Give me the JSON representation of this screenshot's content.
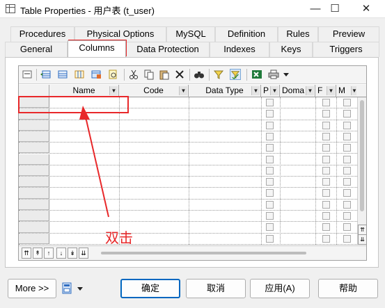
{
  "window": {
    "title": "Table Properties - 用户表 (t_user)",
    "minimize_label": "—",
    "maximize_label": "☐",
    "close_label": "✕"
  },
  "tabs": {
    "row1": [
      "Procedures",
      "Physical Options",
      "MySQL",
      "Definition",
      "Rules",
      "Preview"
    ],
    "row2": [
      "General",
      "Columns",
      "Data Protection",
      "Indexes",
      "Keys",
      "Triggers"
    ],
    "active": "Columns"
  },
  "grid": {
    "columns": [
      "Name",
      "Code",
      "Data Type",
      "P",
      "Doma",
      "F",
      "M"
    ],
    "dropdown_arrow": "▼"
  },
  "toolbar_icons": [
    "properties-icon",
    "insert-row-icon",
    "add-row-icon",
    "add-columns-icon",
    "table-icon",
    "find-icon",
    "cut-icon",
    "copy-icon",
    "paste-icon",
    "delete-icon",
    "find-binoculars-icon",
    "filter-icon",
    "customize-columns-icon",
    "excel-export-icon",
    "print-icon",
    "more-dropdown-icon"
  ],
  "nav_buttons": [
    "⇈",
    "↟",
    "↑",
    "↓",
    "↡",
    "⇊"
  ],
  "scroll_buttons": {
    "top": "⇈",
    "down": "⇊"
  },
  "annotation": {
    "text": "双击",
    "color": "#e8282a"
  },
  "footer": {
    "more": "More >>",
    "ok": "确定",
    "cancel": "取消",
    "apply": "应用(A)",
    "help": "帮助"
  }
}
